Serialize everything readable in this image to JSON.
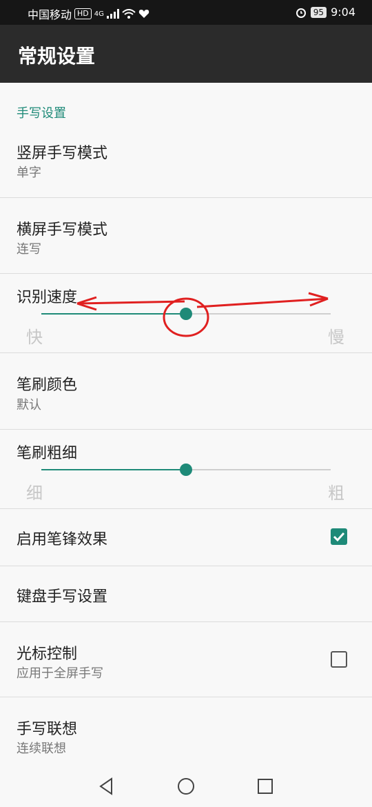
{
  "status": {
    "carrier": "中国移动",
    "hd": "HD",
    "signal_tag": "4G",
    "battery": "95",
    "time": "9:04"
  },
  "app": {
    "title": "常规设置"
  },
  "settings": {
    "section_title": "手写设置",
    "vertical_mode": {
      "title": "竖屏手写模式",
      "value": "单字"
    },
    "horizontal_mode": {
      "title": "横屏手写模式",
      "value": "连写"
    },
    "recognition_speed": {
      "title": "识别速度",
      "min_label": "快",
      "max_label": "慢",
      "level": 0.5
    },
    "brush_color": {
      "title": "笔刷颜色",
      "value": "默认"
    },
    "brush_thickness": {
      "title": "笔刷粗细",
      "min_label": "细",
      "max_label": "粗",
      "level": 0.5
    },
    "stroke_effect": {
      "title": "启用笔锋效果",
      "checked": true
    },
    "keyboard_handwriting": {
      "title": "键盘手写设置"
    },
    "cursor_control": {
      "title": "光标控制",
      "subtitle": "应用于全屏手写",
      "checked": false
    },
    "association": {
      "title": "手写联想",
      "value": "连续联想"
    }
  },
  "colors": {
    "accent": "#1e8a78",
    "appbar": "#2b2b2b",
    "background": "#f8f8f8"
  }
}
